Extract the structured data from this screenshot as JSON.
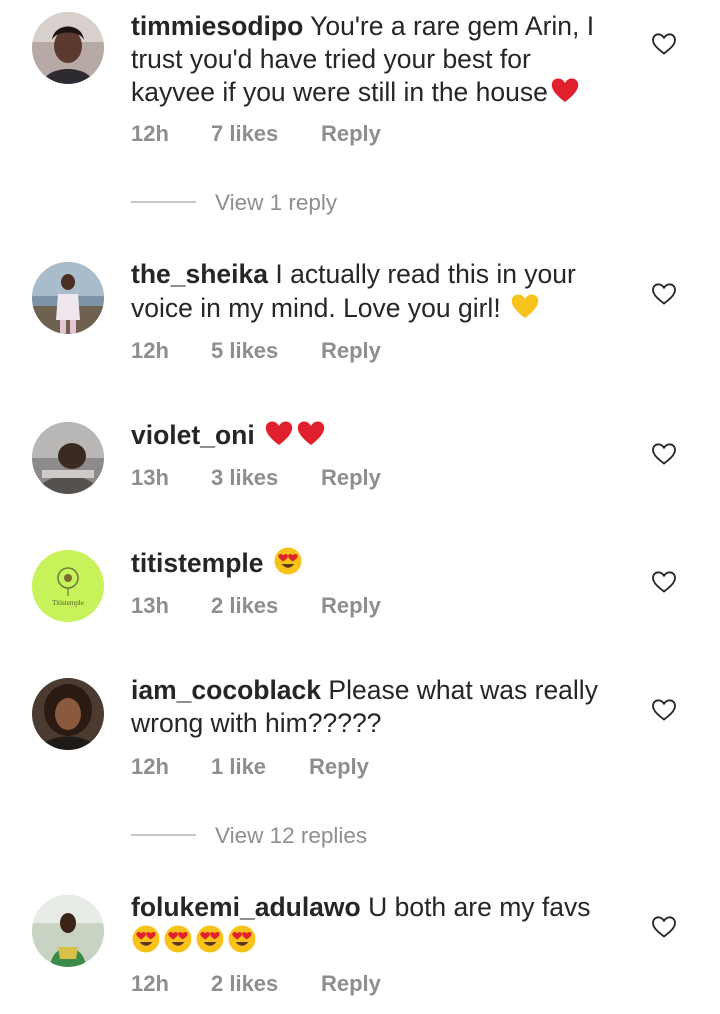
{
  "comments": [
    {
      "username": "timmiesodipo",
      "text": "You're a rare gem Arin, I trust you'd have tried your best for kayvee if you were still in the house",
      "emojis": [
        "red-heart"
      ],
      "time": "12h",
      "likes": "7 likes",
      "reply": "Reply"
    },
    {
      "username": "the_sheika",
      "text": "I actually read this in your voice in my mind. Love you girl!",
      "emojis": [
        "yellow-heart"
      ],
      "time": "12h",
      "likes": "5 likes",
      "reply": "Reply"
    },
    {
      "username": "violet_oni",
      "text": "",
      "emojis": [
        "red-heart",
        "red-heart"
      ],
      "time": "13h",
      "likes": "3 likes",
      "reply": "Reply"
    },
    {
      "username": "titistemple",
      "text": "",
      "emojis": [
        "heart-eyes"
      ],
      "time": "13h",
      "likes": "2 likes",
      "reply": "Reply"
    },
    {
      "username": "iam_cocoblack",
      "text": "Please what was really wrong with him?????",
      "emojis": [],
      "time": "12h",
      "likes": "1 like",
      "reply": "Reply"
    },
    {
      "username": "folukemi_adulawo",
      "text": "U both are my favs",
      "emojis": [
        "heart-eyes",
        "heart-eyes",
        "heart-eyes",
        "heart-eyes"
      ],
      "time": "12h",
      "likes": "2 likes",
      "reply": "Reply"
    }
  ],
  "view_replies": [
    {
      "label": "View 1 reply"
    },
    {
      "label": "View 12 replies"
    }
  ],
  "avatar_text": {
    "titistemple": "Titistemple"
  },
  "colors": {
    "text": "#262626",
    "meta": "#8e8e8e",
    "divider": "#c7c7c7",
    "heart_red": "#e0202d",
    "heart_yellow": "#f7c31a"
  },
  "icons": {
    "like": "heart-outline-icon"
  }
}
